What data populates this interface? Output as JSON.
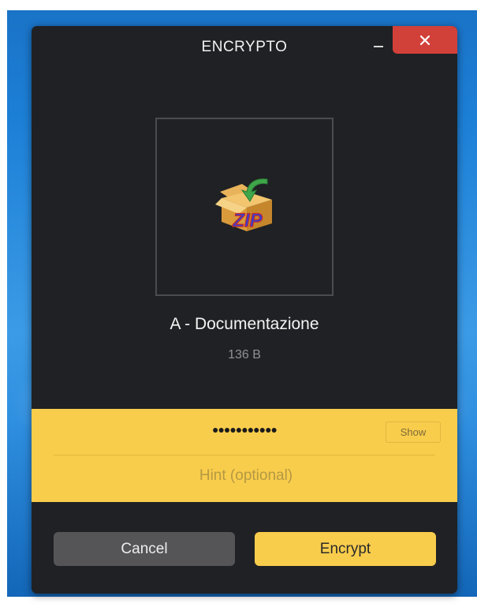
{
  "window": {
    "title": "ENCRYPTO"
  },
  "file": {
    "name": "A - Documentazione",
    "size": "136 B",
    "icon": "zip-archive-icon"
  },
  "password": {
    "masked_value": "●●●●●●●●●●●",
    "show_label": "Show",
    "hint_placeholder": "Hint (optional)"
  },
  "actions": {
    "cancel_label": "Cancel",
    "encrypt_label": "Encrypt"
  },
  "colors": {
    "accent": "#f9cd4c",
    "window_bg": "#1f2124",
    "close_button": "#d2403a",
    "cancel_button": "#555557"
  }
}
